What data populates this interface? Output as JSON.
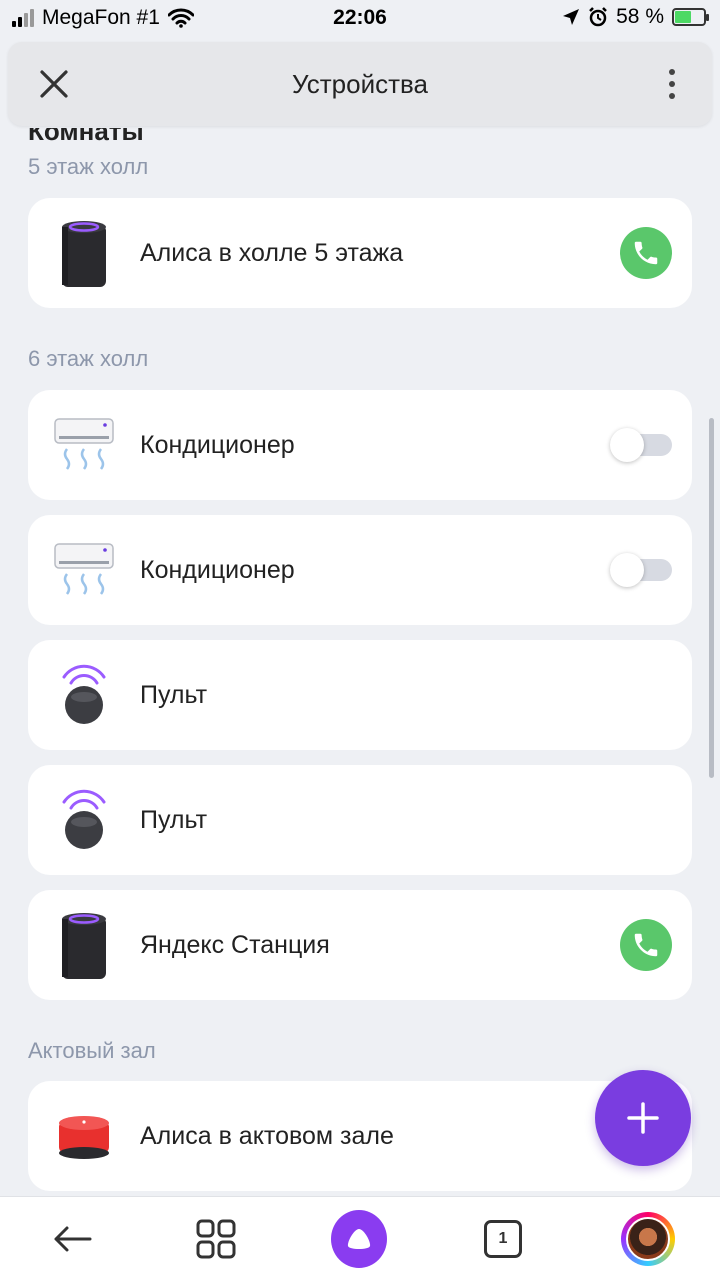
{
  "status_bar": {
    "carrier": "MegaFon #1",
    "time": "22:06",
    "battery_percent": "58 %"
  },
  "header": {
    "title": "Устройства"
  },
  "rooms_heading": "Комнаты",
  "rooms": [
    {
      "name": "5 этаж холл",
      "devices": [
        {
          "name": "Алиса в холле 5 этажа",
          "icon": "smart-speaker-black",
          "control": "call"
        }
      ]
    },
    {
      "name": "6 этаж холл",
      "devices": [
        {
          "name": "Кондиционер",
          "icon": "air-conditioner",
          "control": "toggle",
          "on": false
        },
        {
          "name": "Кондиционер",
          "icon": "air-conditioner",
          "control": "toggle",
          "on": false
        },
        {
          "name": "Пульт",
          "icon": "remote-hub",
          "control": "none"
        },
        {
          "name": "Пульт",
          "icon": "remote-hub",
          "control": "none"
        },
        {
          "name": "Яндекс Станция",
          "icon": "smart-speaker-black",
          "control": "call"
        }
      ]
    },
    {
      "name": "Актовый зал",
      "devices": [
        {
          "name": "Алиса в актовом зале",
          "icon": "smart-speaker-red",
          "control": "none"
        }
      ]
    }
  ],
  "bottom_nav": {
    "tabs_count": "1"
  },
  "colors": {
    "accent": "#7a3de0",
    "call_green": "#5ac76b",
    "room_label": "#8d97ab"
  }
}
